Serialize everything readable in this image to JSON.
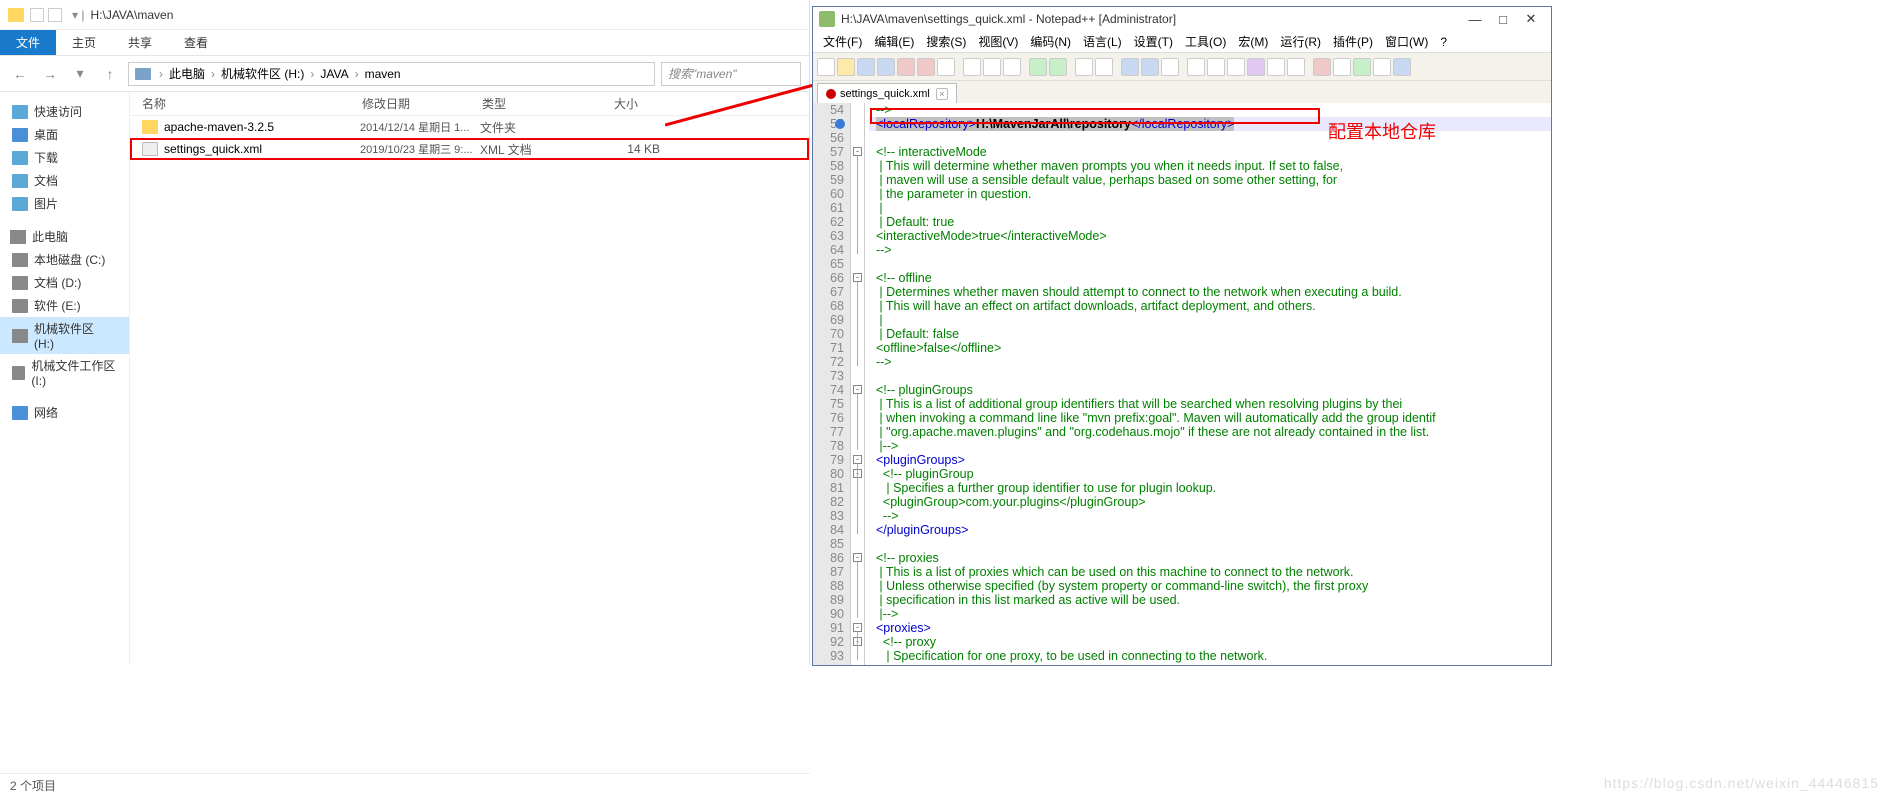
{
  "explorer": {
    "title_path": "H:\\JAVA\\maven",
    "ribbon": {
      "file": "文件",
      "home": "主页",
      "share": "共享",
      "view": "查看"
    },
    "nav": {
      "back": "←",
      "forward": "→",
      "up": "↑"
    },
    "breadcrumb": [
      "此电脑",
      "机械软件区 (H:)",
      "JAVA",
      "maven"
    ],
    "search_placeholder": "搜索\"maven\"",
    "columns": {
      "name": "名称",
      "date": "修改日期",
      "type": "类型",
      "size": "大小"
    },
    "side": {
      "quick": "快速访问",
      "desktop": "桌面",
      "downloads": "下载",
      "documents": "文档",
      "pictures": "图片",
      "thispc": "此电脑",
      "drive_c": "本地磁盘 (C:)",
      "drive_d": "文档 (D:)",
      "drive_e": "软件 (E:)",
      "drive_h": "机械软件区 (H:)",
      "drive_i": "机械文件工作区 (I:)",
      "network": "网络"
    },
    "rows": [
      {
        "name": "apache-maven-3.2.5",
        "date": "2014/12/14 星期日 1...",
        "type": "文件夹",
        "size": ""
      },
      {
        "name": "settings_quick.xml",
        "date": "2019/10/23 星期三 9:...",
        "type": "XML 文档",
        "size": "14 KB"
      }
    ],
    "status": "2 个项目"
  },
  "npp": {
    "title": "H:\\JAVA\\maven\\settings_quick.xml - Notepad++ [Administrator]",
    "menu": [
      "文件(F)",
      "编辑(E)",
      "搜索(S)",
      "视图(V)",
      "编码(N)",
      "语言(L)",
      "设置(T)",
      "工具(O)",
      "宏(M)",
      "运行(R)",
      "插件(P)",
      "窗口(W)",
      "?"
    ],
    "tab": "settings_quick.xml",
    "line_start": 54,
    "lines": [
      "  -->",
      "  <localRepository>H:\\MavenJarAll\\repository</localRepository>",
      "",
      "  <!-- interactiveMode",
      "   | This will determine whether maven prompts you when it needs input. If set to false,",
      "   | maven will use a sensible default value, perhaps based on some other setting, for",
      "   | the parameter in question.",
      "   |",
      "   | Default: true",
      "  <interactiveMode>true</interactiveMode>",
      "  -->",
      "",
      "  <!-- offline",
      "   | Determines whether maven should attempt to connect to the network when executing a build.",
      "   | This will have an effect on artifact downloads, artifact deployment, and others.",
      "   |",
      "   | Default: false",
      "  <offline>false</offline>",
      "  -->",
      "",
      "  <!-- pluginGroups",
      "   | This is a list of additional group identifiers that will be searched when resolving plugins by thei",
      "   | when invoking a command line like \"mvn prefix:goal\". Maven will automatically add the group identif",
      "   | \"org.apache.maven.plugins\" and \"org.codehaus.mojo\" if these are not already contained in the list.",
      "   |-->",
      "  <pluginGroups>",
      "    <!-- pluginGroup",
      "     | Specifies a further group identifier to use for plugin lookup.",
      "    <pluginGroup>com.your.plugins</pluginGroup>",
      "    -->",
      "  </pluginGroups>",
      "",
      "  <!-- proxies",
      "   | This is a list of proxies which can be used on this machine to connect to the network.",
      "   | Unless otherwise specified (by system property or command-line switch), the first proxy",
      "   | specification in this list marked as active will be used.",
      "   |-->",
      "  <proxies>",
      "    <!-- proxy",
      "     | Specification for one proxy, to be used in connecting to the network."
    ]
  },
  "annotation": "配置本地仓库",
  "watermark": "https://blog.csdn.net/weixin_44446815"
}
